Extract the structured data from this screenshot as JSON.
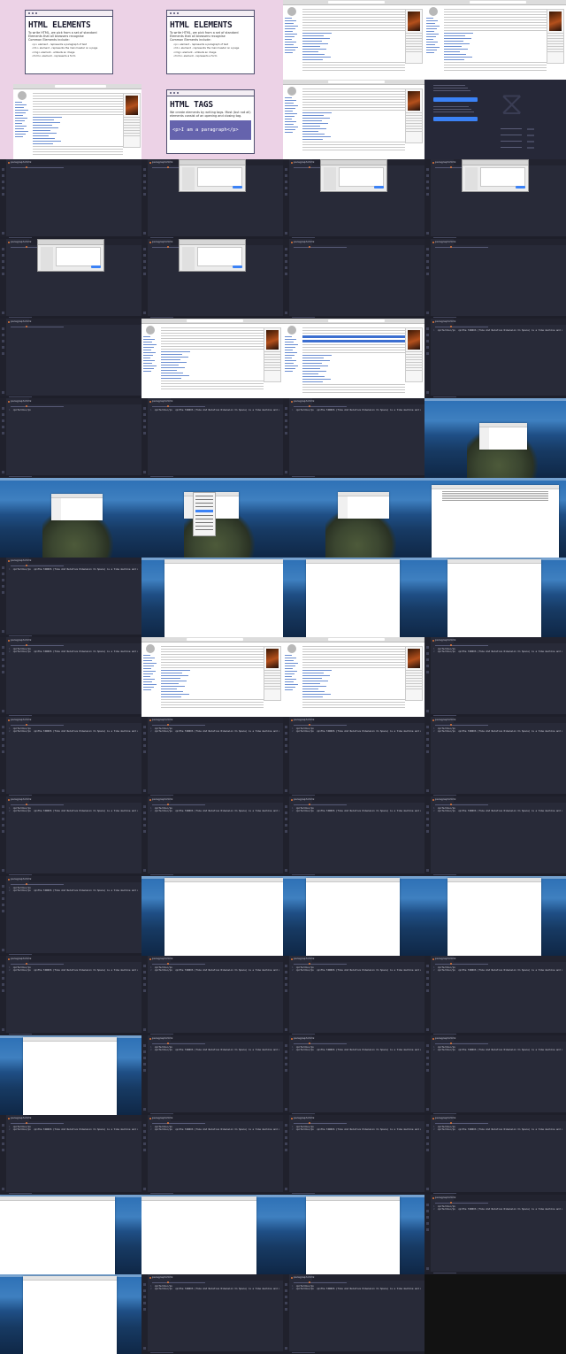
{
  "slides": {
    "elements": {
      "title": "HTML ELEMENTS",
      "subtitle": "To write HTML, we pick from a set of standard Elements that all browsers recognise",
      "list_heading": "Common Elements include:",
      "items": [
        "<p> element - represents a paragraph of text",
        "<h1> element - represents the main header on a page",
        "<img> element - embeds an image",
        "<form> element - represents a form"
      ]
    },
    "tags": {
      "title": "HTML TAGS",
      "subtitle": "We create elements by writing tags. Most (but not all) elements consist of an opening and closing tag.",
      "code": "<p>I am a paragraph</p>"
    }
  },
  "editor": {
    "tab_label": "paragraph.html",
    "line_numbers": [
      "1",
      "2",
      "3"
    ],
    "code_short": "<p>Tardis</p>",
    "code_line": "<p>Tardis</p>  <p>The TARDIS (Time And Relative Dimension In Space) is a time machine and spacecraft in the"
  },
  "colors": {
    "slide_bg": "#ecd2e6",
    "editor_bg": "#282a38",
    "accent_blue": "#3b82f6",
    "tab_modified": "#e3793a"
  }
}
